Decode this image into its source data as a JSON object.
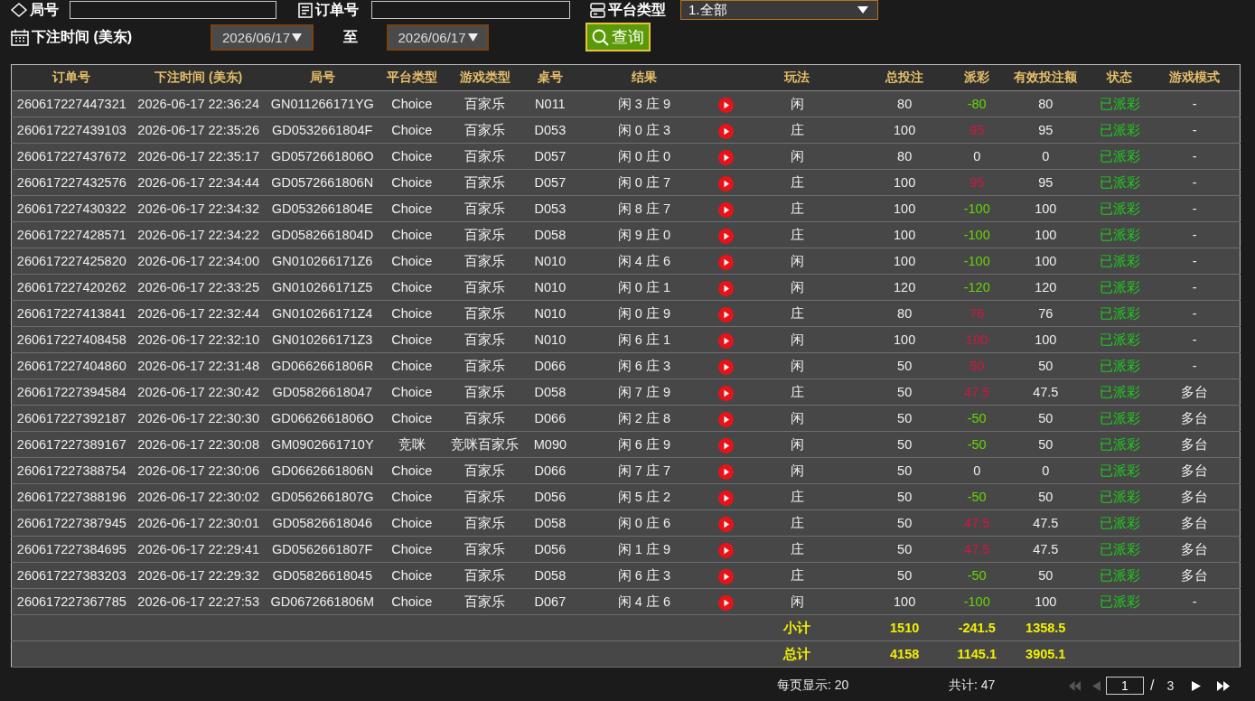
{
  "filters": {
    "round_no": {
      "label": "局号"
    },
    "order_no": {
      "label": "订单号"
    },
    "platform": {
      "label": "平台类型",
      "value": "1.全部"
    },
    "bet_time": {
      "label": "下注时间 (美东)",
      "from": "2026/06/17",
      "separator": "至",
      "to": "2026/06/17"
    },
    "query_button": "查询"
  },
  "table": {
    "columns": [
      "订单号",
      "下注时间 (美东)",
      "局号",
      "平台类型",
      "游戏类型",
      "桌号",
      "结果",
      "玩法",
      "总投注",
      "派彩",
      "有效投注额",
      "状态",
      "游戏模式"
    ],
    "rows": [
      {
        "order_no": "260617227447321",
        "bet_time": "2026-06-17 22:36:24",
        "round_no": "GN011266171YG",
        "platform": "Choice",
        "game_type": "百家乐",
        "table_no": "N011",
        "result": "闲 3 庄 9",
        "bet_type": "闲",
        "total_bet": "80",
        "payout": {
          "text": "-80",
          "color": "#66d600"
        },
        "valid_bet": "80",
        "status": "已派彩",
        "game_mode": "-"
      },
      {
        "order_no": "260617227439103",
        "bet_time": "2026-06-17 22:35:26",
        "round_no": "GD0532661804F",
        "platform": "Choice",
        "game_type": "百家乐",
        "table_no": "D053",
        "result": "闲 0 庄 3",
        "bet_type": "庄",
        "total_bet": "100",
        "payout": {
          "text": "95",
          "color": "#d4163c"
        },
        "valid_bet": "95",
        "status": "已派彩",
        "game_mode": "-"
      },
      {
        "order_no": "260617227437672",
        "bet_time": "2026-06-17 22:35:17",
        "round_no": "GD0572661806O",
        "platform": "Choice",
        "game_type": "百家乐",
        "table_no": "D057",
        "result": "闲 0 庄 0",
        "bet_type": "闲",
        "total_bet": "80",
        "payout": {
          "text": "0",
          "color": "#eeeeee"
        },
        "valid_bet": "0",
        "status": "已派彩",
        "game_mode": "-"
      },
      {
        "order_no": "260617227432576",
        "bet_time": "2026-06-17 22:34:44",
        "round_no": "GD0572661806N",
        "platform": "Choice",
        "game_type": "百家乐",
        "table_no": "D057",
        "result": "闲 0 庄 7",
        "bet_type": "庄",
        "total_bet": "100",
        "payout": {
          "text": "95",
          "color": "#d4163c"
        },
        "valid_bet": "95",
        "status": "已派彩",
        "game_mode": "-"
      },
      {
        "order_no": "260617227430322",
        "bet_time": "2026-06-17 22:34:32",
        "round_no": "GD0532661804E",
        "platform": "Choice",
        "game_type": "百家乐",
        "table_no": "D053",
        "result": "闲 8 庄 7",
        "bet_type": "庄",
        "total_bet": "100",
        "payout": {
          "text": "-100",
          "color": "#66d600"
        },
        "valid_bet": "100",
        "status": "已派彩",
        "game_mode": "-"
      },
      {
        "order_no": "260617227428571",
        "bet_time": "2026-06-17 22:34:22",
        "round_no": "GD0582661804D",
        "platform": "Choice",
        "game_type": "百家乐",
        "table_no": "D058",
        "result": "闲 9 庄 0",
        "bet_type": "庄",
        "total_bet": "100",
        "payout": {
          "text": "-100",
          "color": "#66d600"
        },
        "valid_bet": "100",
        "status": "已派彩",
        "game_mode": "-"
      },
      {
        "order_no": "260617227425820",
        "bet_time": "2026-06-17 22:34:00",
        "round_no": "GN010266171Z6",
        "platform": "Choice",
        "game_type": "百家乐",
        "table_no": "N010",
        "result": "闲 4 庄 6",
        "bet_type": "闲",
        "total_bet": "100",
        "payout": {
          "text": "-100",
          "color": "#66d600"
        },
        "valid_bet": "100",
        "status": "已派彩",
        "game_mode": "-"
      },
      {
        "order_no": "260617227420262",
        "bet_time": "2026-06-17 22:33:25",
        "round_no": "GN010266171Z5",
        "platform": "Choice",
        "game_type": "百家乐",
        "table_no": "N010",
        "result": "闲 0 庄 1",
        "bet_type": "闲",
        "total_bet": "120",
        "payout": {
          "text": "-120",
          "color": "#66d600"
        },
        "valid_bet": "120",
        "status": "已派彩",
        "game_mode": "-"
      },
      {
        "order_no": "260617227413841",
        "bet_time": "2026-06-17 22:32:44",
        "round_no": "GN010266171Z4",
        "platform": "Choice",
        "game_type": "百家乐",
        "table_no": "N010",
        "result": "闲 0 庄 9",
        "bet_type": "庄",
        "total_bet": "80",
        "payout": {
          "text": "76",
          "color": "#d4163c"
        },
        "valid_bet": "76",
        "status": "已派彩",
        "game_mode": "-"
      },
      {
        "order_no": "260617227408458",
        "bet_time": "2026-06-17 22:32:10",
        "round_no": "GN010266171Z3",
        "platform": "Choice",
        "game_type": "百家乐",
        "table_no": "N010",
        "result": "闲 6 庄 1",
        "bet_type": "闲",
        "total_bet": "100",
        "payout": {
          "text": "100",
          "color": "#d4163c"
        },
        "valid_bet": "100",
        "status": "已派彩",
        "game_mode": "-"
      },
      {
        "order_no": "260617227404860",
        "bet_time": "2026-06-17 22:31:48",
        "round_no": "GD0662661806R",
        "platform": "Choice",
        "game_type": "百家乐",
        "table_no": "D066",
        "result": "闲 6 庄 3",
        "bet_type": "闲",
        "total_bet": "50",
        "payout": {
          "text": "50",
          "color": "#d4163c"
        },
        "valid_bet": "50",
        "status": "已派彩",
        "game_mode": "-"
      },
      {
        "order_no": "260617227394584",
        "bet_time": "2026-06-17 22:30:42",
        "round_no": "GD05826618047",
        "platform": "Choice",
        "game_type": "百家乐",
        "table_no": "D058",
        "result": "闲 7 庄 9",
        "bet_type": "庄",
        "total_bet": "50",
        "payout": {
          "text": "47.5",
          "color": "#d4163c"
        },
        "valid_bet": "47.5",
        "status": "已派彩",
        "game_mode": "多台"
      },
      {
        "order_no": "260617227392187",
        "bet_time": "2026-06-17 22:30:30",
        "round_no": "GD0662661806O",
        "platform": "Choice",
        "game_type": "百家乐",
        "table_no": "D066",
        "result": "闲 2 庄 8",
        "bet_type": "闲",
        "total_bet": "50",
        "payout": {
          "text": "-50",
          "color": "#66d600"
        },
        "valid_bet": "50",
        "status": "已派彩",
        "game_mode": "多台"
      },
      {
        "order_no": "260617227389167",
        "bet_time": "2026-06-17 22:30:08",
        "round_no": "GM0902661710Y",
        "platform": "竞咪",
        "game_type": "竞咪百家乐",
        "table_no": "M090",
        "result": "闲 6 庄 9",
        "bet_type": "闲",
        "total_bet": "50",
        "payout": {
          "text": "-50",
          "color": "#66d600"
        },
        "valid_bet": "50",
        "status": "已派彩",
        "game_mode": "多台"
      },
      {
        "order_no": "260617227388754",
        "bet_time": "2026-06-17 22:30:06",
        "round_no": "GD0662661806N",
        "platform": "Choice",
        "game_type": "百家乐",
        "table_no": "D066",
        "result": "闲 7 庄 7",
        "bet_type": "闲",
        "total_bet": "50",
        "payout": {
          "text": "0",
          "color": "#eeeeee"
        },
        "valid_bet": "0",
        "status": "已派彩",
        "game_mode": "多台"
      },
      {
        "order_no": "260617227388196",
        "bet_time": "2026-06-17 22:30:02",
        "round_no": "GD0562661807G",
        "platform": "Choice",
        "game_type": "百家乐",
        "table_no": "D056",
        "result": "闲 5 庄 2",
        "bet_type": "庄",
        "total_bet": "50",
        "payout": {
          "text": "-50",
          "color": "#66d600"
        },
        "valid_bet": "50",
        "status": "已派彩",
        "game_mode": "多台"
      },
      {
        "order_no": "260617227387945",
        "bet_time": "2026-06-17 22:30:01",
        "round_no": "GD05826618046",
        "platform": "Choice",
        "game_type": "百家乐",
        "table_no": "D058",
        "result": "闲 0 庄 6",
        "bet_type": "庄",
        "total_bet": "50",
        "payout": {
          "text": "47.5",
          "color": "#d4163c"
        },
        "valid_bet": "47.5",
        "status": "已派彩",
        "game_mode": "多台"
      },
      {
        "order_no": "260617227384695",
        "bet_time": "2026-06-17 22:29:41",
        "round_no": "GD0562661807F",
        "platform": "Choice",
        "game_type": "百家乐",
        "table_no": "D056",
        "result": "闲 1 庄 9",
        "bet_type": "庄",
        "total_bet": "50",
        "payout": {
          "text": "47.5",
          "color": "#d4163c"
        },
        "valid_bet": "47.5",
        "status": "已派彩",
        "game_mode": "多台"
      },
      {
        "order_no": "260617227383203",
        "bet_time": "2026-06-17 22:29:32",
        "round_no": "GD05826618045",
        "platform": "Choice",
        "game_type": "百家乐",
        "table_no": "D058",
        "result": "闲 6 庄 3",
        "bet_type": "庄",
        "total_bet": "50",
        "payout": {
          "text": "-50",
          "color": "#66d600"
        },
        "valid_bet": "50",
        "status": "已派彩",
        "game_mode": "多台"
      },
      {
        "order_no": "260617227367785",
        "bet_time": "2026-06-17 22:27:53",
        "round_no": "GD0672661806M",
        "platform": "Choice",
        "game_type": "百家乐",
        "table_no": "D067",
        "result": "闲 4 庄 6",
        "bet_type": "闲",
        "total_bet": "100",
        "payout": {
          "text": "-100",
          "color": "#66d600"
        },
        "valid_bet": "100",
        "status": "已派彩",
        "game_mode": "-"
      }
    ],
    "summary_rows": [
      {
        "label": "小计",
        "total_bet": "1510",
        "payout": "-241.5",
        "valid_bet": "1358.5"
      },
      {
        "label": "总计",
        "total_bet": "4158",
        "payout": "1145.1",
        "valid_bet": "3905.1"
      }
    ]
  },
  "pagination": {
    "per_page": "每页显示: 20",
    "total": "共计: 47",
    "page": "1",
    "separator": "/",
    "pages": "3",
    "buttons": [
      {
        "kind": "first",
        "disabled": true
      },
      {
        "kind": "previous",
        "disabled": true
      },
      {
        "kind": "next",
        "disabled": false
      },
      {
        "kind": "last",
        "disabled": false
      }
    ]
  }
}
